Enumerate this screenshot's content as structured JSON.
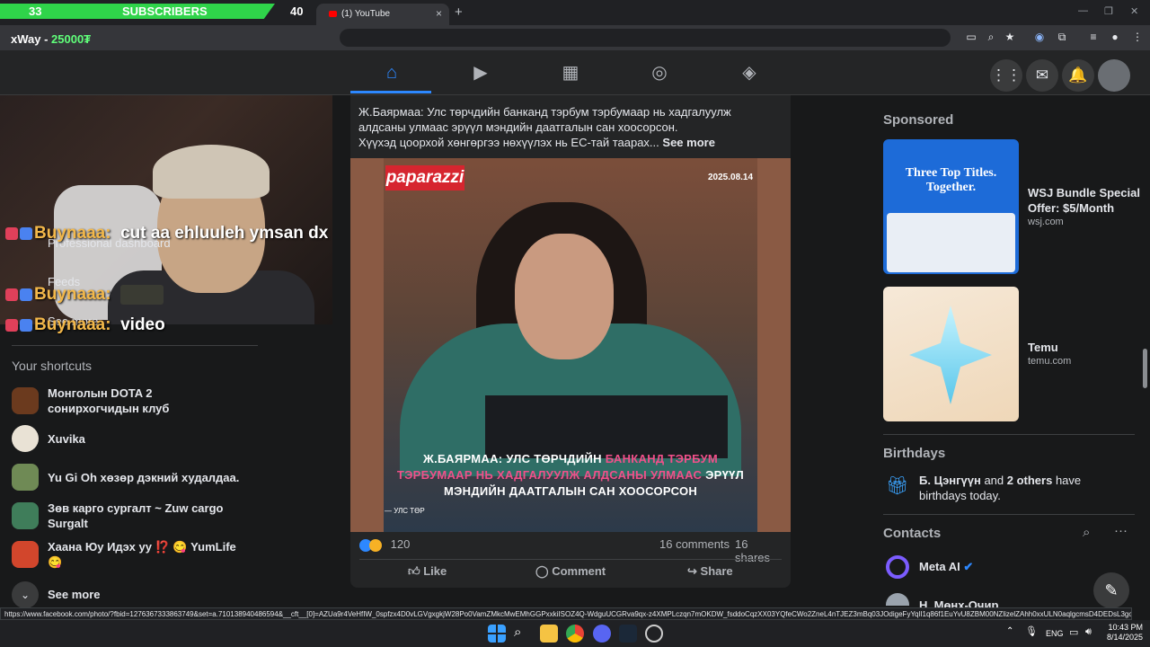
{
  "browser": {
    "tab_title": "(1) YouTube",
    "new_tab": "+",
    "min": "—",
    "restore": "❐",
    "close": "✕"
  },
  "stream_overlay": {
    "sub_current": "33",
    "sub_label": "SUBSCRIBERS",
    "sub_goal": "40",
    "goal_fraction": 0.825,
    "donor_name": "xWay - ",
    "donor_amount": "25000₮",
    "chat": [
      {
        "user": "Buynaaa:",
        "msg": "cut aa ehluuleh ymsan dx"
      },
      {
        "user": "Buynaaa:",
        "msg": ""
      },
      {
        "user": "Buynaaa:",
        "msg": "video"
      }
    ]
  },
  "left_nav": {
    "professional_dashboard": "Professional dashboard",
    "feeds": "Feeds",
    "see_more_top": "See more",
    "shortcuts_title": "Your shortcuts",
    "shortcuts": [
      {
        "label": "Монголын DOTA 2 сонирхогчидын клуб",
        "color": "#6b3a1e"
      },
      {
        "label": "Xuvika",
        "color": "#e9e2d5"
      },
      {
        "label": "Yu Gi Oh хөзөр дэкний худалдаа.",
        "color": "#6f8a55"
      },
      {
        "label": "Зөв карго сургалт ~ Zuw cargo Surgalt",
        "color": "#3f7d5a"
      },
      {
        "label": "Хаана Юу Идэх уу ⁉️ 😋 YumLife😋",
        "color": "#d2462c"
      }
    ],
    "see_more": "See more"
  },
  "post": {
    "text_line1": "Ж.Баярмаа: Улс төрчдийн банканд тэрбум тэрбумаар нь хадгалуулж алдсаны улмаас эрүүл мэндийн даатгалын сан хоосорсон.",
    "text_line2": "Хүүхэд цоорхой хөнгөргээ нөхүүлэх нь ЕС-тай таарах...",
    "see_more": "See more",
    "photo_logo": "paparazzi",
    "photo_date": "2025.08.14",
    "headline_a": "Ж.БАЯРМАА: УЛС ТӨРЧДИЙН ",
    "headline_b": "БАНКАНД ТЭРБУМ ТЭРБУМААР НЬ ХАДГАЛУУЛЖ АЛДСАНЫ УЛМААС",
    "headline_c": " ЭРҮҮЛ МЭНДИЙН ДААТГАЛЫН САН ХООСОРСОН",
    "photo_footer": "— УЛС ТӨР",
    "reaction_count": "120",
    "comments": "16 comments",
    "shares": "16 shares",
    "like": "Like",
    "comment": "Comment",
    "share": "Share"
  },
  "right": {
    "sponsored": "Sponsored",
    "ads": [
      {
        "title": "WSJ Bundle Special Offer: $5/Month",
        "domain": "wsj.com"
      },
      {
        "title": "Temu",
        "domain": "temu.com"
      }
    ],
    "wsj_banner": "Three Top Titles. Together.",
    "birthdays": "Birthdays",
    "birthday_name": "Б. Цэнгүүн",
    "birthday_and": " and ",
    "birthday_others": "2 others",
    "birthday_rest": " have birthdays today.",
    "contacts": "Contacts",
    "contact_1": "Meta AI",
    "contact_2": "Н. Мөнх-Очир"
  },
  "status_url": "https://www.facebook.com/photo/?fbid=1276367333863749&set=a.710138940486594&__cft__[0]=AZUa9r4VeHfIW_0spfzx4D0vLGVgxgkjW28Po0VamZMkcMwEMhGGPxxkiISOZ4Q-WdguUCGRva9qx-z4XMPLczqn7mOKDW_fsddoCqzXX03YQfeCWo2ZneL4nTJEZ3mBq03JOdigeFyYqlI1q86f1EuYvU8ZBM00NZlizelZAhh0xxULN0aqlgcmsD4DEDsL3goa89rrT1-",
  "taskbar": {
    "lang": "ENG",
    "time": "10:43 PM",
    "date": "8/14/2025"
  }
}
